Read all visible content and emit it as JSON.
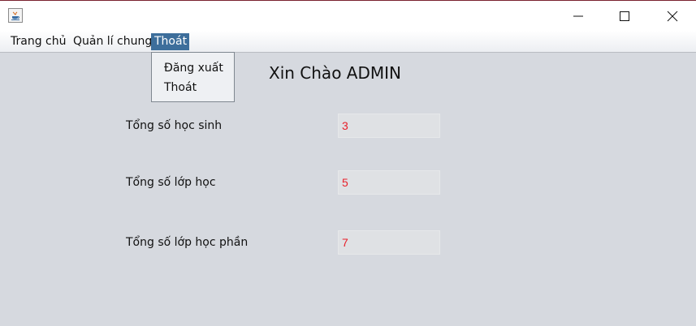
{
  "menu": {
    "items": [
      {
        "label": "Trang chủ"
      },
      {
        "label": "Quản lí chung"
      },
      {
        "label": "Thoát"
      }
    ],
    "dropdown": {
      "items": [
        {
          "label": "Đăng xuất"
        },
        {
          "label": "Thoát"
        }
      ]
    }
  },
  "main": {
    "welcome": "Xin Chào ADMIN",
    "stats": [
      {
        "label": "Tổng số học sinh",
        "value": "3"
      },
      {
        "label": "Tổng số lớp học",
        "value": "5"
      },
      {
        "label": "Tổng số lớp học phần",
        "value": "7"
      }
    ]
  },
  "colors": {
    "menu_selected": "#3d6e9b",
    "value_text": "#e8202a",
    "background": "#d6d9df"
  },
  "icons": [
    "java-app-icon",
    "minimize-icon",
    "maximize-icon",
    "close-icon"
  ]
}
